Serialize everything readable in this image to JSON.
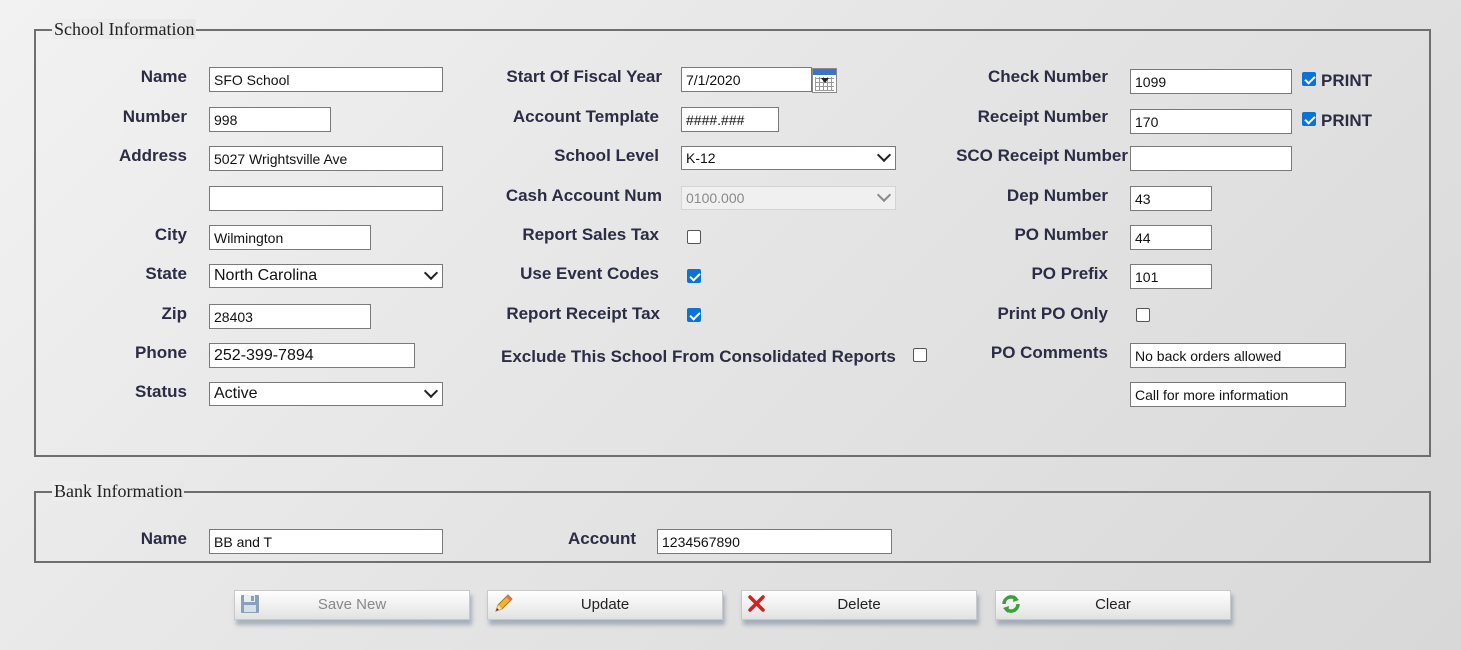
{
  "school": {
    "legend": "School Information",
    "name": {
      "label": "Name",
      "value": "SFO School"
    },
    "number": {
      "label": "Number",
      "value": "998"
    },
    "address": {
      "label": "Address",
      "value1": "5027 Wrightsville Ave",
      "value2": ""
    },
    "city": {
      "label": "City",
      "value": "Wilmington"
    },
    "state": {
      "label": "State",
      "value": "North Carolina"
    },
    "zip": {
      "label": "Zip",
      "value": "28403"
    },
    "phone": {
      "label": "Phone",
      "value": "252-399-7894"
    },
    "status": {
      "label": "Status",
      "value": "Active"
    },
    "fiscal_year": {
      "label": "Start Of Fiscal Year",
      "value": "7/1/2020"
    },
    "account_template": {
      "label": "Account Template",
      "value": "####.###"
    },
    "school_level": {
      "label": "School Level",
      "value": "K-12"
    },
    "cash_account": {
      "label": "Cash Account Num",
      "value": "0100.000"
    },
    "report_sales_tax": {
      "label": "Report Sales Tax",
      "checked": false
    },
    "use_event_codes": {
      "label": "Use Event Codes",
      "checked": true
    },
    "report_receipt_tax": {
      "label": "Report Receipt Tax",
      "checked": true
    },
    "exclude_consolidated": {
      "label": "Exclude This School From Consolidated Reports",
      "checked": false
    },
    "check_number": {
      "label": "Check Number",
      "value": "1099",
      "print_label": "PRINT",
      "print_checked": true
    },
    "receipt_number": {
      "label": "Receipt Number",
      "value": "170",
      "print_label": "PRINT",
      "print_checked": true
    },
    "sco_receipt_number": {
      "label": "SCO Receipt Number",
      "value": ""
    },
    "dep_number": {
      "label": "Dep Number",
      "value": "43"
    },
    "po_number": {
      "label": "PO Number",
      "value": "44"
    },
    "po_prefix": {
      "label": "PO Prefix",
      "value": "101"
    },
    "print_po_only": {
      "label": "Print PO Only",
      "checked": false
    },
    "po_comments": {
      "label": "PO Comments",
      "value1": "No back orders allowed",
      "value2": "Call for more information"
    }
  },
  "bank": {
    "legend": "Bank Information",
    "name": {
      "label": "Name",
      "value": "BB and T"
    },
    "account": {
      "label": "Account",
      "value": "1234567890"
    }
  },
  "buttons": {
    "save_new": "Save New",
    "update": "Update",
    "delete": "Delete",
    "clear": "Clear"
  }
}
